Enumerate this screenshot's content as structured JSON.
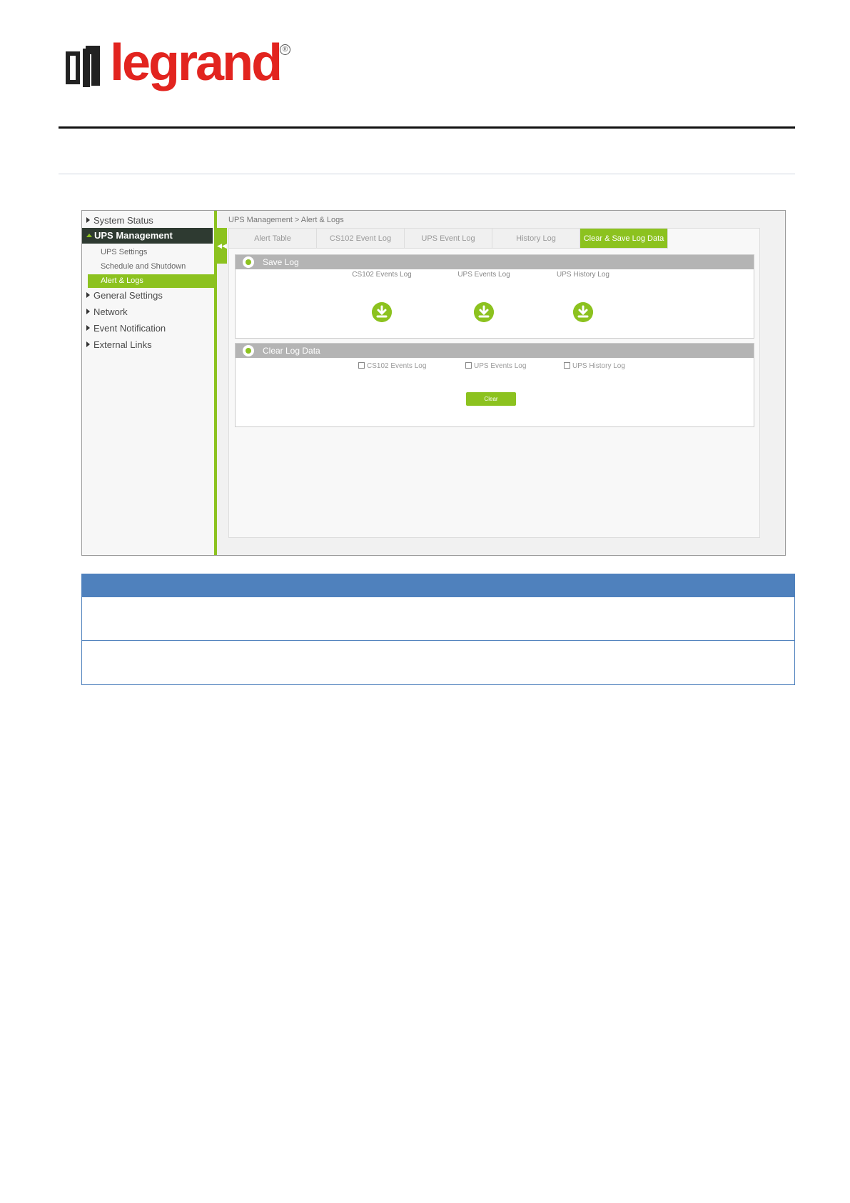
{
  "brand": {
    "name": "legrand",
    "registered_mark": "®",
    "accent_color": "#e2241f"
  },
  "sidebar": {
    "items": [
      {
        "label": "System Status"
      },
      {
        "label": "UPS Management"
      },
      {
        "label": "General Settings"
      },
      {
        "label": "Network"
      },
      {
        "label": "Event Notification"
      },
      {
        "label": "External Links"
      }
    ],
    "sub_items": [
      {
        "label": "UPS Settings"
      },
      {
        "label": "Schedule and Shutdown"
      },
      {
        "label": "Alert & Logs"
      }
    ],
    "collapse_icon": "double-chevron-left-icon"
  },
  "breadcrumb": "UPS Management > Alert & Logs",
  "tabs": [
    {
      "label": "Alert Table"
    },
    {
      "label": "CS102 Event Log"
    },
    {
      "label": "UPS Event Log"
    },
    {
      "label": "History Log"
    },
    {
      "label": "Clear & Save Log Data"
    }
  ],
  "save_log": {
    "title": "Save Log",
    "downloads": [
      {
        "label": "CS102 Events Log",
        "icon": "download-icon"
      },
      {
        "label": "UPS Events Log",
        "icon": "download-icon"
      },
      {
        "label": "UPS History Log",
        "icon": "download-icon"
      }
    ]
  },
  "clear_log": {
    "title": "Clear Log Data",
    "checkboxes": [
      {
        "label": "CS102 Events Log"
      },
      {
        "label": "UPS Events Log"
      },
      {
        "label": "UPS History Log"
      }
    ],
    "button_label": "Clear"
  },
  "theme": {
    "green": "#8cc21f",
    "dark": "#2e3a31",
    "table_blue": "#4f81bd"
  }
}
